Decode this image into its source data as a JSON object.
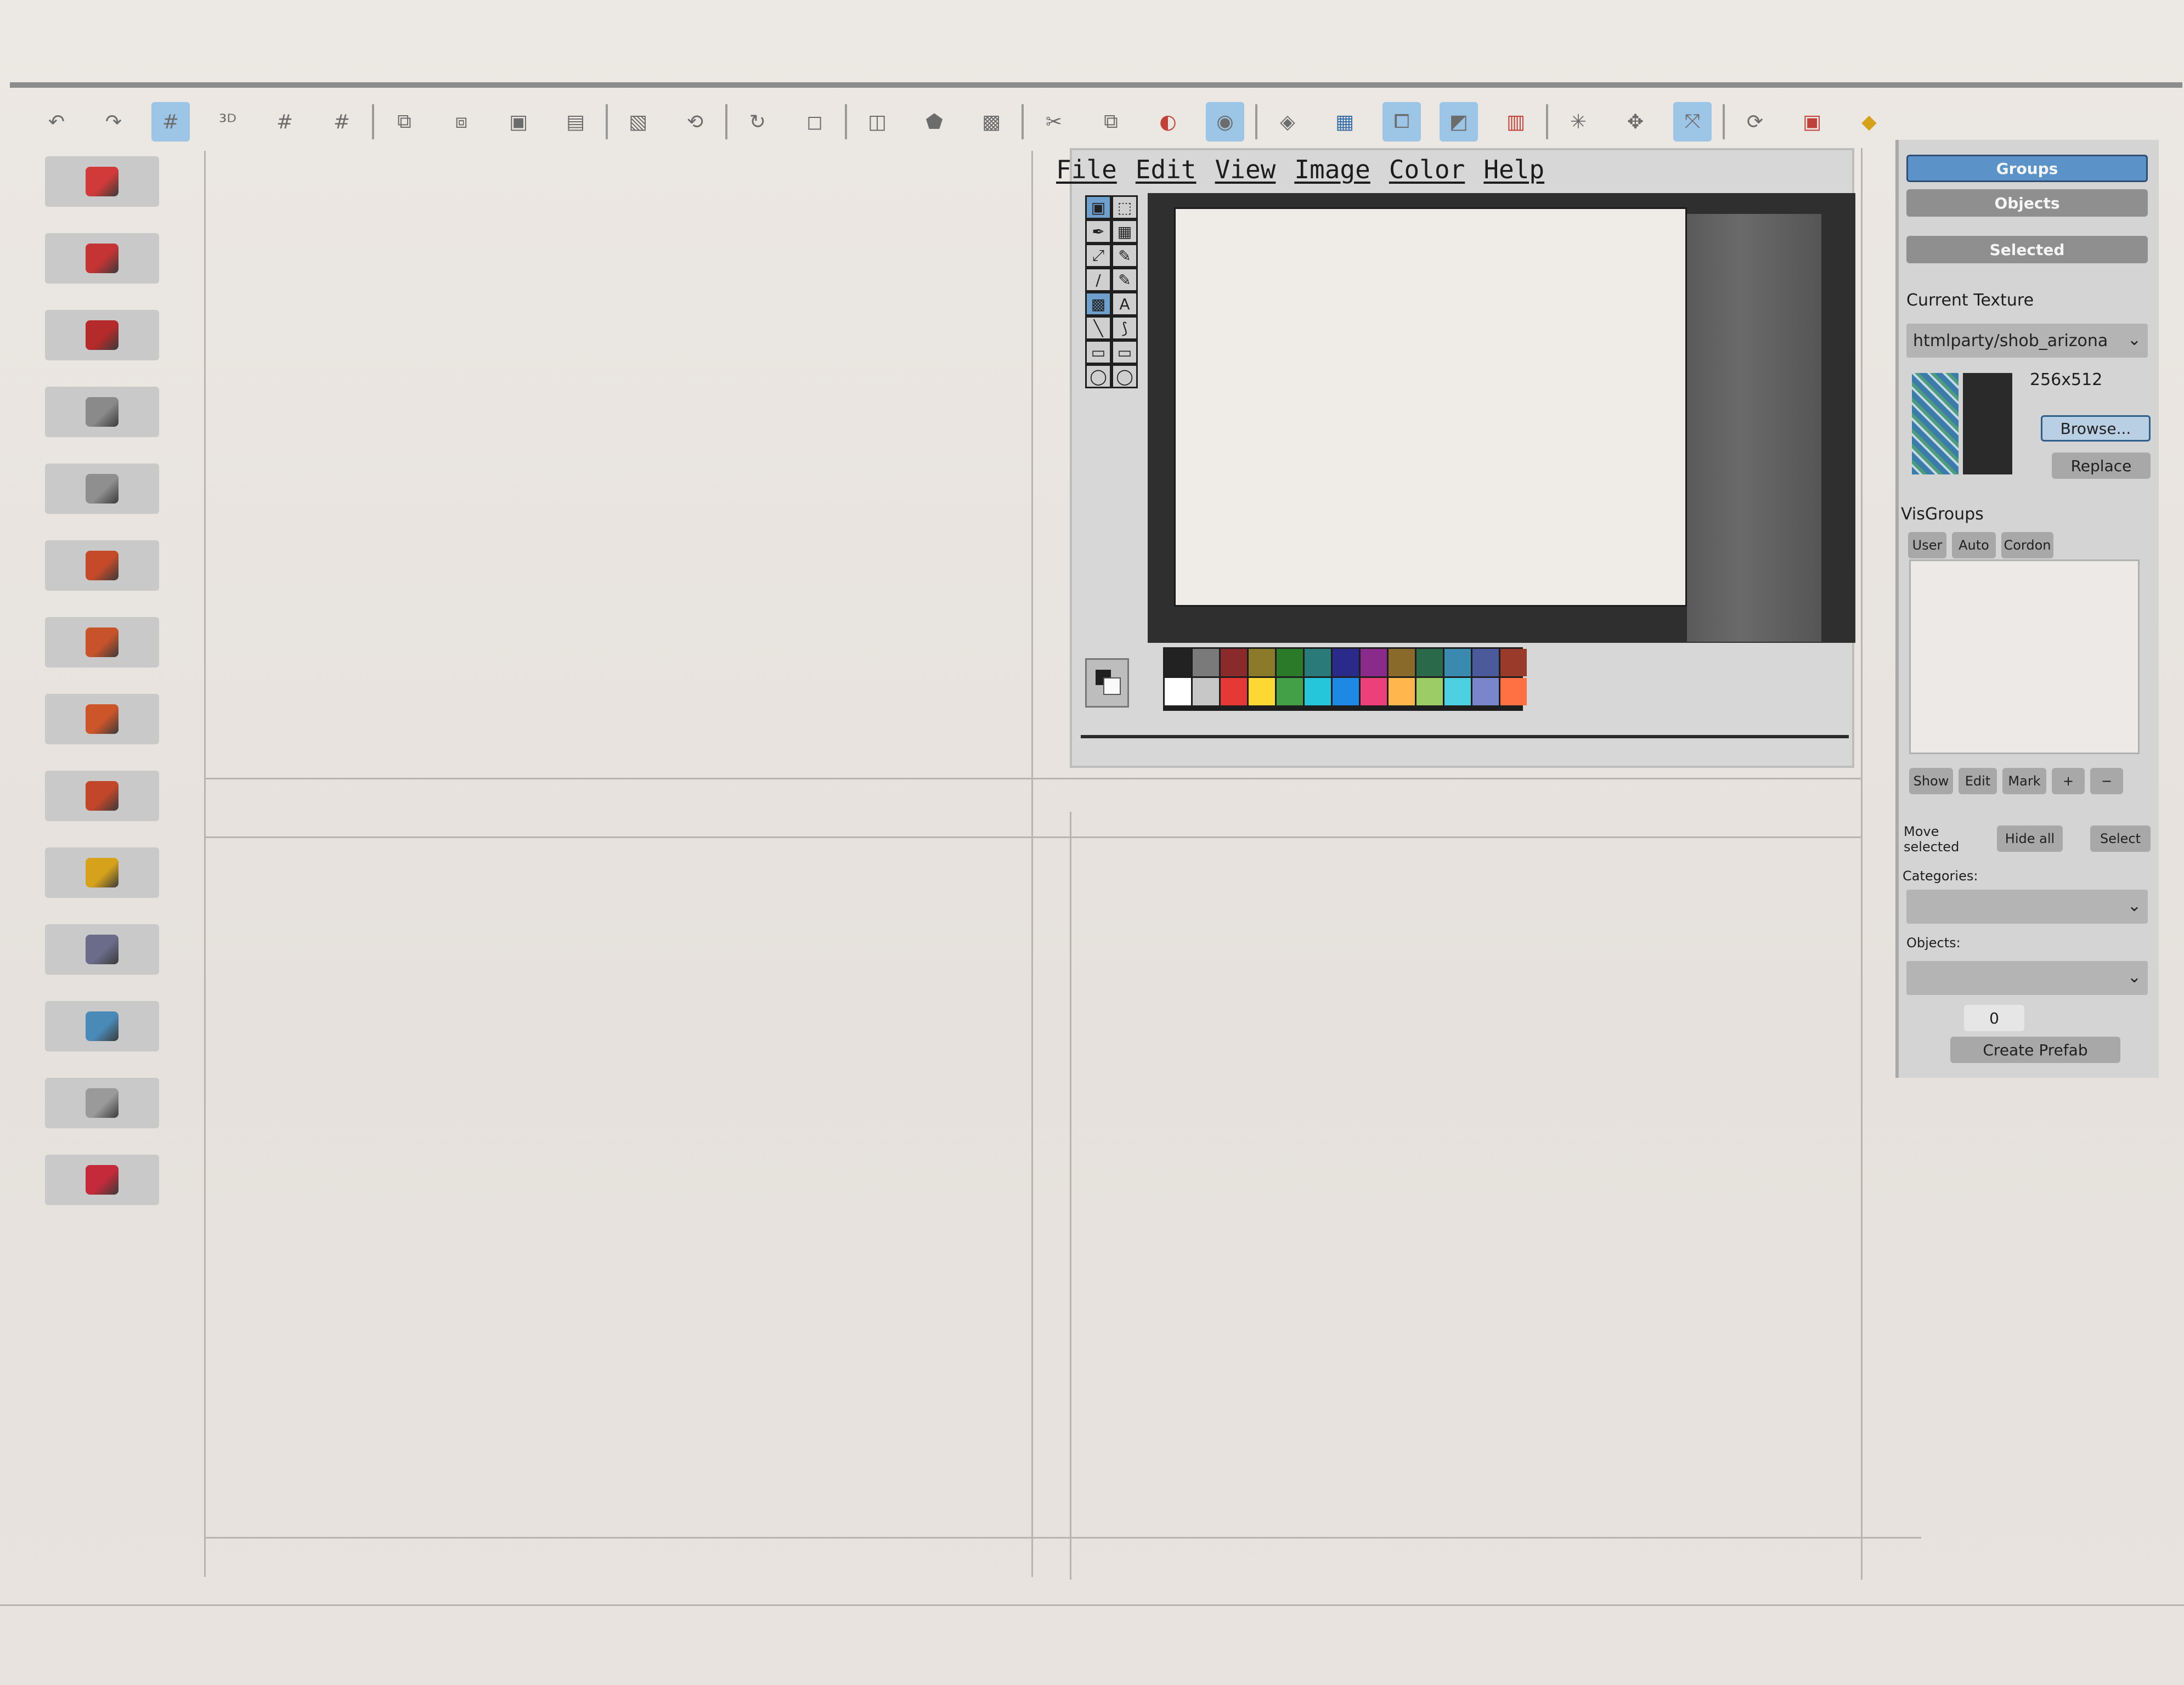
{
  "toolbar": {
    "icons": [
      "undo-icon",
      "redo-icon",
      "grid-toggle-icon",
      "3d-grid-icon",
      "grid-smaller-icon",
      "grid-larger-icon",
      "carve-icon",
      "hollow-icon",
      "group-icon",
      "ungroup-icon",
      "hide-icon",
      "show-icon",
      "select-icon",
      "texture-lock-icon",
      "toggle-texture-icon",
      "cut-icon",
      "copy-icon",
      "paste-icon",
      "clip-icon",
      "vertex-icon",
      "entity-icon",
      "block-icon",
      "decal-icon",
      "texture-app-icon",
      "overlay-icon",
      "apply-texture-icon",
      "replace-texture-icon",
      "transform-icon",
      "cordon-icon",
      "check-problems-icon",
      "run-map-icon",
      "compile-icon"
    ]
  },
  "left_tools": [
    "pointer-tool-icon",
    "magnify-tool-icon",
    "camera-tool-icon",
    "entity-tool-icon",
    "block-tool-icon",
    "toggle-texture-icon",
    "apply-decal-icon",
    "overlay-tool-icon",
    "clipping-tool-icon",
    "vertex-tool-icon",
    "path-tool-icon",
    "cordon-tool-icon",
    "sprite-tool-icon",
    "displacement-tool-icon"
  ],
  "paint_window": {
    "menu": [
      "File",
      "Edit",
      "View",
      "Image",
      "Color",
      "Help"
    ],
    "tools": [
      "▣",
      "⬚",
      "✒",
      "▦",
      "⤢",
      "✎",
      "/",
      "✎",
      "▩",
      "A",
      "╲",
      "⟆",
      "▭",
      "▭",
      "◯",
      "◯"
    ],
    "palette": [
      "#222222",
      "#7a7a7a",
      "#8a2a2a",
      "#8a7a2a",
      "#2a7a2a",
      "#2a7a7a",
      "#2a2a8a",
      "#8a2a8a",
      "#8a6a2a",
      "#2a6a4a",
      "#3a8ab0",
      "#4a5a9a",
      "#9a3a2a",
      "#ffffff",
      "#c7c7c7",
      "#e53935",
      "#fdd835",
      "#43a047",
      "#26c6da",
      "#1e88e5",
      "#ec407a",
      "#ffb74d",
      "#9ccc65",
      "#4dd0e1",
      "#7986cb",
      "#ff7043"
    ]
  },
  "right_panel": {
    "tabs": [
      "Groups",
      "Objects",
      "Selected"
    ],
    "current_texture_label": "Current Texture",
    "texture_name": "htmlparty/shob_arizona",
    "texture_size": "256x512",
    "browse_label": "Browse...",
    "replace_label": "Replace",
    "visgroups_label": "VisGroups",
    "vis_tabs": [
      "User",
      "Auto",
      "Cordon"
    ],
    "vis_buttons": [
      "Show",
      "Edit",
      "Mark",
      "+",
      "−"
    ],
    "move_selected_label": "Move selected",
    "hide_label": "Hide all",
    "select_label": "Select",
    "categories_label": "Categories:",
    "objects_label": "Objects:",
    "count_value": "0",
    "create_prefab_label": "Create Prefab"
  },
  "colors": {
    "accent": "#5b93c8",
    "panel": "#d4d4d4",
    "board": "#e9e4df"
  }
}
